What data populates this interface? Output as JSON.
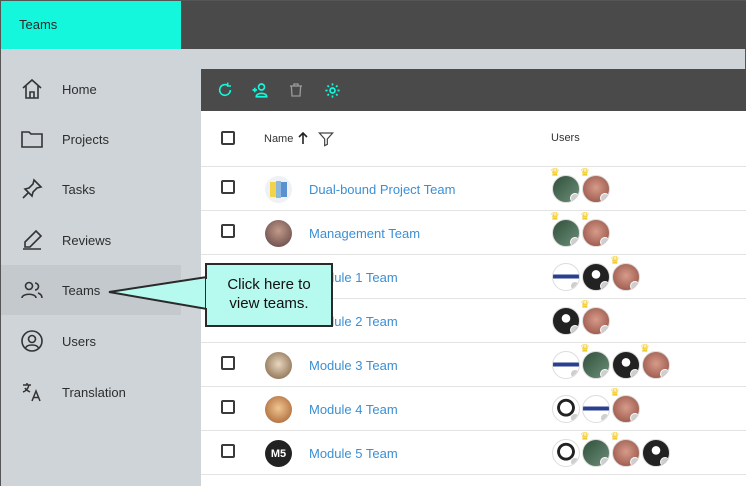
{
  "app": {
    "title": "Teams"
  },
  "sidebar": {
    "items": [
      {
        "label": "Home",
        "icon": "home-icon"
      },
      {
        "label": "Projects",
        "icon": "folder-icon"
      },
      {
        "label": "Tasks",
        "icon": "pin-icon"
      },
      {
        "label": "Reviews",
        "icon": "pen-icon"
      },
      {
        "label": "Teams",
        "icon": "people-icon",
        "active": true
      },
      {
        "label": "Users",
        "icon": "user-circle-icon"
      },
      {
        "label": "Translation",
        "icon": "translate-icon"
      }
    ]
  },
  "toolbar": {
    "icons": [
      "refresh-icon",
      "add-user-icon",
      "trash-icon",
      "settings-icon"
    ],
    "accent_color": "#14f7dc"
  },
  "table": {
    "headers": {
      "name": "Name",
      "users": "Users"
    },
    "rows": [
      {
        "name": "Dual-bound Project Team",
        "avatar": "flag"
      },
      {
        "name": "Management Team",
        "avatar": "person"
      },
      {
        "name": "Module 1 Team",
        "avatar": "hidden"
      },
      {
        "name": "Module 2 Team",
        "avatar": "hidden"
      },
      {
        "name": "Module 3 Team",
        "avatar": "person"
      },
      {
        "name": "Module 4 Team",
        "avatar": "person"
      },
      {
        "name": "Module 5 Team",
        "avatar": "M5"
      }
    ]
  },
  "callout": {
    "line1": "Click here to",
    "line2": "view teams."
  },
  "colors": {
    "brand": "#14f7dc",
    "topbar": "#4a4a4a",
    "sidebar": "#cfd4d8",
    "link": "#3b8fd4",
    "callout": "#b6f9ef"
  }
}
